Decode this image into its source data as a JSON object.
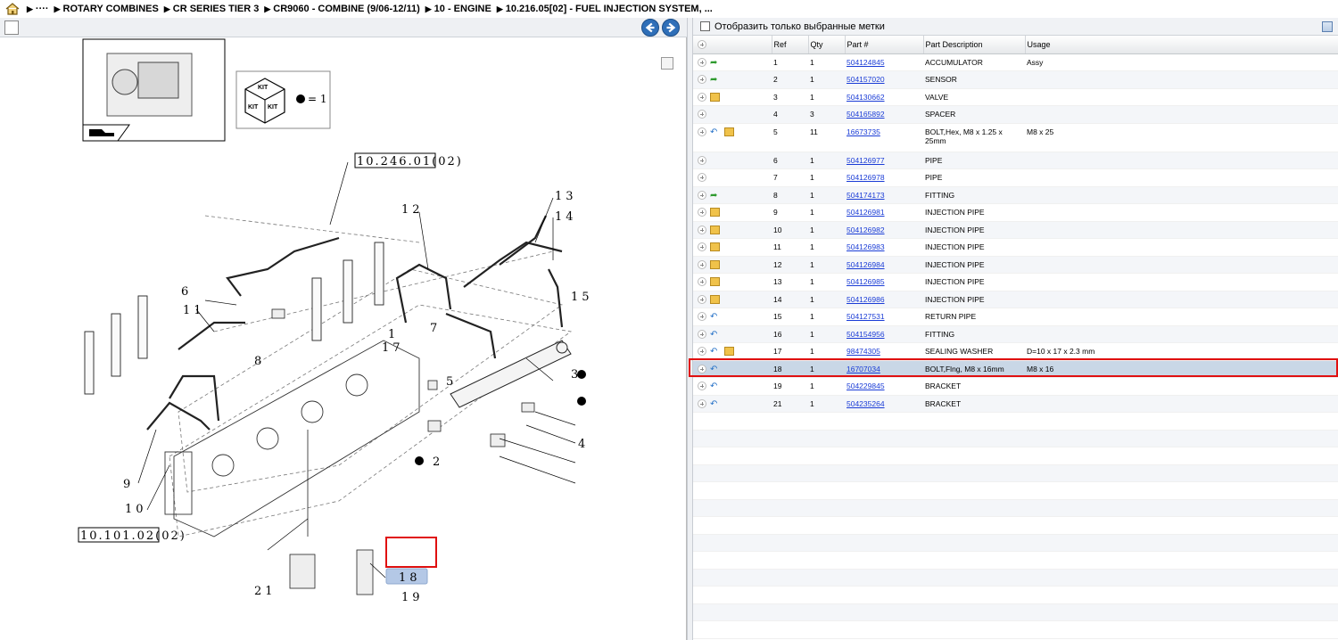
{
  "breadcrumb": {
    "items": [
      "····",
      "ROTARY COMBINES",
      "CR SERIES TIER 3",
      "CR9060 - COMBINE (9/06-12/11)",
      "10 - ENGINE",
      "10.216.05[02] - FUEL INJECTION SYSTEM, ..."
    ]
  },
  "filter": {
    "label": "Отобразить только выбранные метки"
  },
  "table": {
    "headers": [
      "",
      "Ref",
      "Qty",
      "Part #",
      "Part Description",
      "Usage"
    ],
    "rows": [
      {
        "icons": [
          "green-arrow-icon"
        ],
        "ref": "1",
        "qty": "1",
        "part": "504124845",
        "desc": "ACCUMULATOR",
        "usage": "Assy"
      },
      {
        "icons": [
          "green-arrow-icon"
        ],
        "ref": "2",
        "qty": "1",
        "part": "504157020",
        "desc": "SENSOR",
        "usage": ""
      },
      {
        "icons": [
          "box-icon"
        ],
        "ref": "3",
        "qty": "1",
        "part": "504130662",
        "desc": "VALVE",
        "usage": ""
      },
      {
        "icons": [],
        "ref": "4",
        "qty": "3",
        "part": "504165892",
        "desc": "SPACER",
        "usage": ""
      },
      {
        "icons": [
          "blue-arrow-icon",
          "box-icon"
        ],
        "ref": "5",
        "qty": "11",
        "part": "16673735",
        "desc": "BOLT,Hex, M8 x 1.25 x 25mm",
        "usage": "M8 x 25"
      },
      {
        "icons": [],
        "ref": "6",
        "qty": "1",
        "part": "504126977",
        "desc": "PIPE",
        "usage": ""
      },
      {
        "icons": [],
        "ref": "7",
        "qty": "1",
        "part": "504126978",
        "desc": "PIPE",
        "usage": ""
      },
      {
        "icons": [
          "green-arrow-icon"
        ],
        "ref": "8",
        "qty": "1",
        "part": "504174173",
        "desc": "FITTING",
        "usage": ""
      },
      {
        "icons": [
          "box-icon"
        ],
        "ref": "9",
        "qty": "1",
        "part": "504126981",
        "desc": "INJECTION PIPE",
        "usage": ""
      },
      {
        "icons": [
          "box-icon"
        ],
        "ref": "10",
        "qty": "1",
        "part": "504126982",
        "desc": "INJECTION PIPE",
        "usage": ""
      },
      {
        "icons": [
          "box-icon"
        ],
        "ref": "11",
        "qty": "1",
        "part": "504126983",
        "desc": "INJECTION PIPE",
        "usage": ""
      },
      {
        "icons": [
          "box-icon"
        ],
        "ref": "12",
        "qty": "1",
        "part": "504126984",
        "desc": "INJECTION PIPE",
        "usage": ""
      },
      {
        "icons": [
          "box-icon"
        ],
        "ref": "13",
        "qty": "1",
        "part": "504126985",
        "desc": "INJECTION PIPE",
        "usage": ""
      },
      {
        "icons": [
          "box-icon"
        ],
        "ref": "14",
        "qty": "1",
        "part": "504126986",
        "desc": "INJECTION PIPE",
        "usage": ""
      },
      {
        "icons": [
          "blue-arrow-icon"
        ],
        "ref": "15",
        "qty": "1",
        "part": "504127531",
        "desc": "RETURN PIPE",
        "usage": ""
      },
      {
        "icons": [
          "blue-arrow-icon"
        ],
        "ref": "16",
        "qty": "1",
        "part": "504154956",
        "desc": "FITTING",
        "usage": ""
      },
      {
        "icons": [
          "blue-arrow-icon",
          "box-icon"
        ],
        "ref": "17",
        "qty": "1",
        "part": "98474305",
        "desc": "SEALING WASHER",
        "usage": "D=10 x 17 x 2.3 mm"
      },
      {
        "icons": [
          "blue-arrow-icon"
        ],
        "ref": "18",
        "qty": "1",
        "part": "16707034",
        "desc": "BOLT,Flng, M8 x 16mm",
        "usage": "M8 x 16",
        "selected": true
      },
      {
        "icons": [
          "blue-arrow-icon"
        ],
        "ref": "19",
        "qty": "1",
        "part": "504229845",
        "desc": "BRACKET",
        "usage": ""
      },
      {
        "icons": [
          "blue-arrow-icon"
        ],
        "ref": "21",
        "qty": "1",
        "part": "504235264",
        "desc": "BRACKET",
        "usage": ""
      }
    ]
  },
  "drawing": {
    "ref_top": "10.246.01(02)",
    "ref_bottom": "10.101.02(02)",
    "kit_label": "KIT",
    "kit_qty": "= 1",
    "callouts": [
      "1",
      "2",
      "3",
      "4",
      "5",
      "6",
      "7",
      "8",
      "9",
      "10",
      "11",
      "12",
      "13",
      "14",
      "15",
      "17",
      "18",
      "19",
      "21"
    ]
  },
  "colors": {
    "highlight": "#e01010",
    "selected_row": "#c9d7e6",
    "link": "#1a3cd6"
  }
}
